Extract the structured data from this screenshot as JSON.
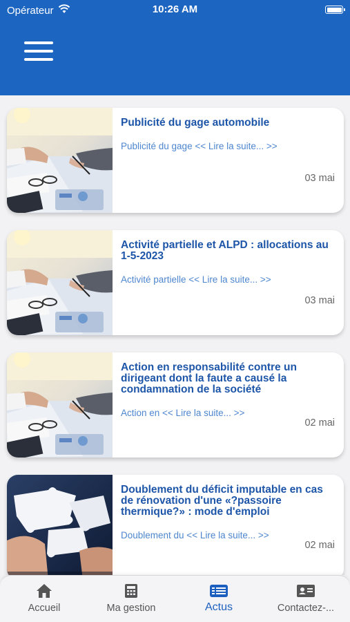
{
  "status_bar": {
    "carrier": "Opérateur",
    "time": "10:26 AM"
  },
  "header": {
    "menu_icon": "hamburger-menu-icon",
    "background": "#1c66c2"
  },
  "articles": [
    {
      "title": "Publicité du gage automobile",
      "excerpt": "Publicité du gage << Lire la suite... >>",
      "date": "03 mai",
      "image": "office-meeting-photo"
    },
    {
      "title": "Activité partielle et ALPD : allocations au 1-5-2023",
      "excerpt": "Activité partielle << Lire la suite... >>",
      "date": "03 mai",
      "image": "office-meeting-photo"
    },
    {
      "title": "Action en responsabilité contre un dirigeant dont la faute a causé la condamnation de la société",
      "excerpt": "Action en << Lire la suite... >>",
      "date": "02 mai",
      "image": "office-meeting-photo"
    },
    {
      "title": "Doublement du déficit imputable en cas de rénovation d'une «?passoire thermique?» : mode d'emploi",
      "excerpt": "Doublement du << Lire la suite... >>",
      "date": "02 mai",
      "image": "puzzle-pieces-photo"
    }
  ],
  "tabs": [
    {
      "label": "Accueil",
      "icon": "home-icon"
    },
    {
      "label": "Ma gestion",
      "icon": "calculator-icon"
    },
    {
      "label": "Actus",
      "icon": "news-list-icon",
      "active": true
    },
    {
      "label": "Contactez-...",
      "icon": "contact-card-icon"
    }
  ],
  "colors": {
    "accent": "#1c66c2",
    "title": "#1d55a8",
    "link": "#4d86cf"
  }
}
